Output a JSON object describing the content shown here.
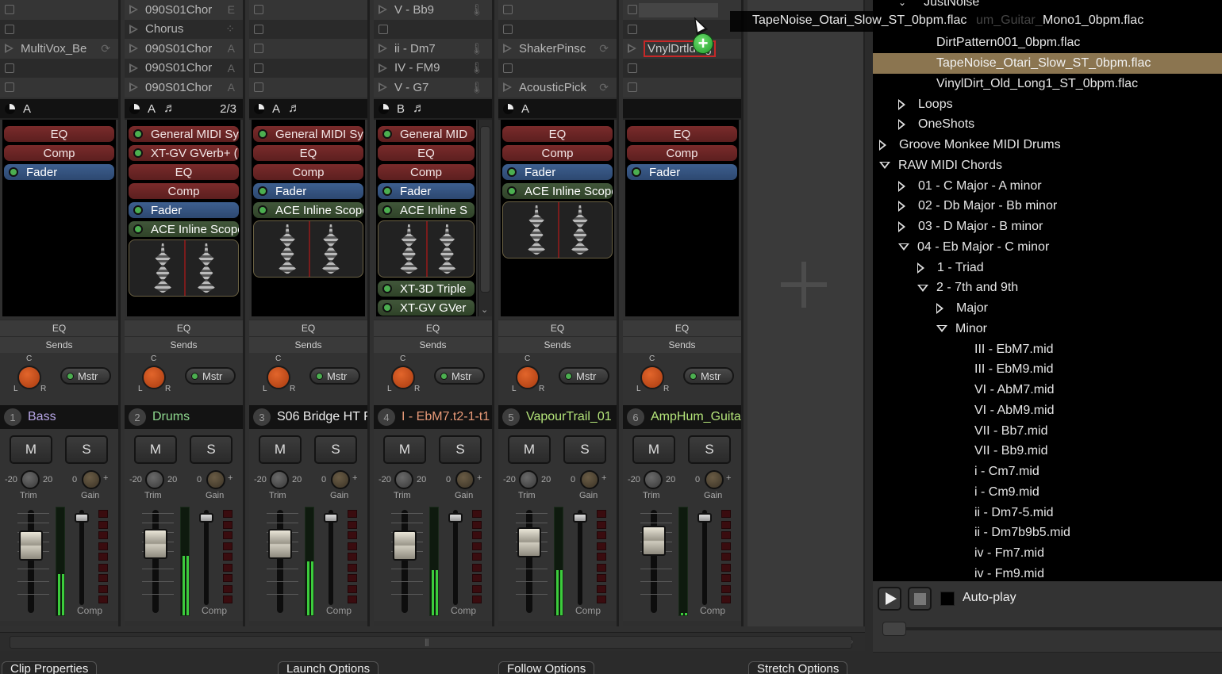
{
  "drag": {
    "label": "TapeNoise_Otari_Slow_ST_0bpm.flac",
    "ghost_text": "um_Guitar_",
    "rest_text": "Mono1_0bpm.flac",
    "badge": "+"
  },
  "tracks": [
    {
      "number": "1",
      "name": "Bass",
      "name_color": "#b7a6e6",
      "clips": [
        {
          "type": "empty"
        },
        {
          "type": "empty"
        },
        {
          "type": "clip",
          "name": "MultiVox_Be",
          "icon": "⟳"
        },
        {
          "type": "empty"
        },
        {
          "type": "empty"
        }
      ],
      "bar": {
        "icon": "clock-icon",
        "scene": "A",
        "note": "",
        "ratio": ""
      },
      "plugins": [
        {
          "name": "EQ",
          "kind": "red"
        },
        {
          "name": "Comp",
          "kind": "red"
        },
        {
          "name": "Fader",
          "kind": "blue"
        }
      ],
      "scope": false,
      "eq_label": "EQ",
      "sends_label": "Sends",
      "mstr_label": "Mstr",
      "mute": "M",
      "solo": "S",
      "trim_label": "Trim",
      "gain_label": "Gain",
      "trim_min": "-20",
      "trim_max": "20",
      "gain_min": "0",
      "gain_max": "+",
      "comp_label": "Comp",
      "fader_level": 0.72,
      "meter_level": 0.38
    },
    {
      "number": "2",
      "name": "Drums",
      "name_color": "#8fd98f",
      "clips": [
        {
          "type": "clip",
          "name": "090S01Chor",
          "icon": "E"
        },
        {
          "type": "clip",
          "name": "Chorus",
          "icon": "⁘"
        },
        {
          "type": "clip",
          "name": "090S01Chor",
          "icon": "A"
        },
        {
          "type": "clip",
          "name": "090S01Chor",
          "icon": "A"
        },
        {
          "type": "clip",
          "name": "090S01Chor",
          "icon": "A"
        }
      ],
      "bar": {
        "icon": "clock-icon",
        "scene": "A",
        "note": "♬",
        "ratio": "2/3"
      },
      "plugins": [
        {
          "name": "General MIDI Sy",
          "kind": "red",
          "led": true
        },
        {
          "name": "XT-GV GVerb+ (",
          "kind": "red",
          "led": true
        },
        {
          "name": "EQ",
          "kind": "red"
        },
        {
          "name": "Comp",
          "kind": "red"
        },
        {
          "name": "Fader",
          "kind": "blue"
        },
        {
          "name": "ACE Inline Scope",
          "kind": "green"
        }
      ],
      "scope": true,
      "eq_label": "EQ",
      "sends_label": "Sends",
      "mstr_label": "Mstr",
      "mute": "M",
      "solo": "S",
      "trim_label": "Trim",
      "gain_label": "Gain",
      "trim_min": "-20",
      "trim_max": "20",
      "gain_min": "0",
      "gain_max": "+",
      "comp_label": "Comp",
      "fader_level": 0.74,
      "meter_level": 0.55
    },
    {
      "number": "3",
      "name": "S06 Bridge HT F",
      "name_color": "#f0f0f0",
      "clips": [
        {
          "type": "empty"
        },
        {
          "type": "empty"
        },
        {
          "type": "empty"
        },
        {
          "type": "empty"
        },
        {
          "type": "empty"
        }
      ],
      "bar": {
        "icon": "clock-icon",
        "scene": "A",
        "note": "♬",
        "ratio": ""
      },
      "plugins": [
        {
          "name": "General MIDI Sy",
          "kind": "red",
          "led": true
        },
        {
          "name": "EQ",
          "kind": "red"
        },
        {
          "name": "Comp",
          "kind": "red"
        },
        {
          "name": "Fader",
          "kind": "blue"
        },
        {
          "name": "ACE Inline Scope",
          "kind": "green"
        }
      ],
      "scope": true,
      "eq_label": "EQ",
      "sends_label": "Sends",
      "mstr_label": "Mstr",
      "mute": "M",
      "solo": "S",
      "trim_label": "Trim",
      "gain_label": "Gain",
      "trim_min": "-20",
      "trim_max": "20",
      "gain_min": "0",
      "gain_max": "+",
      "comp_label": "Comp",
      "fader_level": 0.74,
      "meter_level": 0.5
    },
    {
      "number": "4",
      "name": "I - EbM7.t2-1-t1",
      "name_color": "#e89a78",
      "clips": [
        {
          "type": "clip",
          "name": "V - Bb9",
          "icon": "🌡"
        },
        {
          "type": "empty"
        },
        {
          "type": "clip",
          "name": "ii - Dm7",
          "icon": "🌡"
        },
        {
          "type": "clip",
          "name": "IV - FM9",
          "icon": "🌡"
        },
        {
          "type": "clip",
          "name": "V - G7",
          "icon": "🌡"
        }
      ],
      "bar": {
        "icon": "clock-icon",
        "scene": "B",
        "note": "♬",
        "ratio": ""
      },
      "plugins": [
        {
          "name": "General MID",
          "kind": "red",
          "led": true
        },
        {
          "name": "EQ",
          "kind": "red"
        },
        {
          "name": "Comp",
          "kind": "red"
        },
        {
          "name": "Fader",
          "kind": "blue"
        },
        {
          "name": "ACE Inline S",
          "kind": "green"
        }
      ],
      "plugins_after_scope": [
        {
          "name": "XT-3D Triple",
          "kind": "green"
        },
        {
          "name": "XT-GV GVer",
          "kind": "green"
        }
      ],
      "scope": true,
      "scrollable": true,
      "eq_label": "EQ",
      "sends_label": "Sends",
      "mstr_label": "Mstr",
      "mute": "M",
      "solo": "S",
      "trim_label": "Trim",
      "gain_label": "Gain",
      "trim_min": "-20",
      "trim_max": "20",
      "gain_min": "0",
      "gain_max": "+",
      "comp_label": "Comp",
      "fader_level": 0.72,
      "meter_level": 0.42
    },
    {
      "number": "5",
      "name": "VapourTrail_01",
      "name_color": "#b5e67a",
      "clips": [
        {
          "type": "empty"
        },
        {
          "type": "empty"
        },
        {
          "type": "clip",
          "name": "ShakerPinsc",
          "icon": "⟳"
        },
        {
          "type": "empty"
        },
        {
          "type": "clip",
          "name": "AcousticPick",
          "icon": "⟳"
        }
      ],
      "bar": {
        "icon": "clock-icon",
        "scene": "A",
        "note": "",
        "ratio": ""
      },
      "plugins": [
        {
          "name": "EQ",
          "kind": "red"
        },
        {
          "name": "Comp",
          "kind": "red"
        },
        {
          "name": "Fader",
          "kind": "blue"
        },
        {
          "name": "ACE Inline Scope",
          "kind": "green"
        }
      ],
      "scope": true,
      "eq_label": "EQ",
      "sends_label": "Sends",
      "mstr_label": "Mstr",
      "mute": "M",
      "solo": "S",
      "trim_label": "Trim",
      "gain_label": "Gain",
      "trim_min": "-20",
      "trim_max": "20",
      "gain_min": "0",
      "gain_max": "+",
      "comp_label": "Comp",
      "fader_level": 0.76,
      "meter_level": 0.42
    },
    {
      "number": "6",
      "name": "AmpHum_Guita",
      "name_color": "#b5e67a",
      "clips": [
        {
          "type": "empty-slot"
        },
        {
          "type": "empty"
        },
        {
          "type": "drop",
          "name": "VnylDrtlding",
          "icon": ""
        },
        {
          "type": "empty"
        },
        {
          "type": "empty"
        }
      ],
      "bar": {
        "icon": "",
        "scene": "",
        "note": "",
        "ratio": ""
      },
      "plugins": [
        {
          "name": "EQ",
          "kind": "red"
        },
        {
          "name": "Comp",
          "kind": "red"
        },
        {
          "name": "Fader",
          "kind": "blue"
        }
      ],
      "scope": false,
      "eq_label": "EQ",
      "sends_label": "Sends",
      "mstr_label": "Mstr",
      "mute": "M",
      "solo": "S",
      "trim_label": "Trim",
      "gain_label": "Gain",
      "trim_min": "-20",
      "trim_max": "20",
      "gain_min": "0",
      "gain_max": "+",
      "comp_label": "Comp",
      "fader_level": 0.78,
      "meter_level": 0.02
    }
  ],
  "browser": {
    "rows": [
      {
        "label": "JustNoise",
        "indent": 1,
        "exp": "chev",
        "partial": true
      },
      {
        "label": "",
        "indent": 3,
        "exp": "none",
        "hidden_by_drag": true
      },
      {
        "label": "DirtPattern001_0bpm.flac",
        "indent": 3,
        "exp": "none"
      },
      {
        "label": "TapeNoise_Otari_Slow_ST_0bpm.flac",
        "indent": 3,
        "exp": "none",
        "selected": true
      },
      {
        "label": "VinylDirt_Old_Long1_ST_0bpm.flac",
        "indent": 3,
        "exp": "none"
      },
      {
        "label": "Loops",
        "indent": 1,
        "exp": "closed"
      },
      {
        "label": "OneShots",
        "indent": 1,
        "exp": "closed"
      },
      {
        "label": "Groove Monkee MIDI Drums",
        "indent": 0,
        "exp": "closed"
      },
      {
        "label": "RAW MIDI Chords",
        "indent": 0,
        "exp": "open"
      },
      {
        "label": "01 - C Major - A minor",
        "indent": 1,
        "exp": "closed"
      },
      {
        "label": "02 - Db Major - Bb minor",
        "indent": 1,
        "exp": "closed"
      },
      {
        "label": "03 - D Major - B minor",
        "indent": 1,
        "exp": "closed"
      },
      {
        "label": "04 - Eb Major - C minor",
        "indent": 1,
        "exp": "open"
      },
      {
        "label": "1 - Triad",
        "indent": 2,
        "exp": "closed"
      },
      {
        "label": "2 - 7th and 9th",
        "indent": 2,
        "exp": "open"
      },
      {
        "label": "Major",
        "indent": 3,
        "exp": "closed"
      },
      {
        "label": "Minor",
        "indent": 3,
        "exp": "open"
      },
      {
        "label": "III - EbM7.mid",
        "indent": 5,
        "exp": "none"
      },
      {
        "label": "III - EbM9.mid",
        "indent": 5,
        "exp": "none"
      },
      {
        "label": "VI - AbM7.mid",
        "indent": 5,
        "exp": "none"
      },
      {
        "label": "VI - AbM9.mid",
        "indent": 5,
        "exp": "none"
      },
      {
        "label": "VII - Bb7.mid",
        "indent": 5,
        "exp": "none"
      },
      {
        "label": "VII - Bb9.mid",
        "indent": 5,
        "exp": "none"
      },
      {
        "label": "i - Cm7.mid",
        "indent": 5,
        "exp": "none"
      },
      {
        "label": "i - Cm9.mid",
        "indent": 5,
        "exp": "none"
      },
      {
        "label": "ii - Dm7-5.mid",
        "indent": 5,
        "exp": "none"
      },
      {
        "label": "ii - Dm7b9b5.mid",
        "indent": 5,
        "exp": "none"
      },
      {
        "label": "iv - Fm7.mid",
        "indent": 5,
        "exp": "none"
      },
      {
        "label": "iv - Fm9.mid",
        "indent": 5,
        "exp": "none"
      }
    ],
    "controls": {
      "autoplay_label": "Auto-play",
      "autoplay_checked": false,
      "volume": 0.0
    }
  },
  "bottom_tabs": [
    "Clip Properties",
    "Launch Options",
    "Follow Options",
    "Stretch Options"
  ],
  "colors": {
    "selected_row": "#8b7550",
    "drop_target_border": "#c62828",
    "led_on": "#4caf50"
  }
}
